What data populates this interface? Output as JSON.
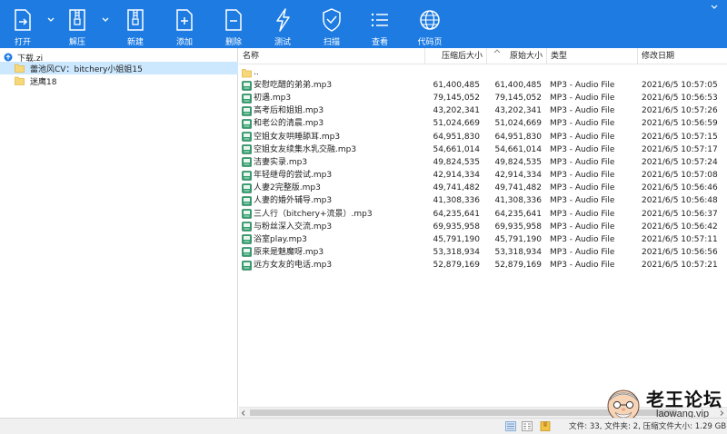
{
  "toolbar": {
    "buttons": [
      {
        "label": "打开",
        "icon": "open-icon"
      },
      {
        "label": "解压",
        "icon": "extract-icon"
      },
      {
        "label": "新建",
        "icon": "new-archive-icon"
      },
      {
        "label": "添加",
        "icon": "add-file-icon"
      },
      {
        "label": "删除",
        "icon": "delete-file-icon"
      },
      {
        "label": "测试",
        "icon": "test-icon"
      },
      {
        "label": "扫描",
        "icon": "scan-shield-icon"
      },
      {
        "label": "查看",
        "icon": "view-list-icon"
      },
      {
        "label": "代码页",
        "icon": "globe-icon"
      }
    ],
    "background": "#1d7be2"
  },
  "tree": {
    "root": "下载.zi",
    "items": [
      {
        "label": "蕾池风CV：bitchery小姐姐15",
        "selected": true
      },
      {
        "label": "迷鹰18",
        "selected": false
      }
    ]
  },
  "columns": {
    "name": "名称",
    "compressed": "压缩后大小",
    "original": "原始大小",
    "type": "类型",
    "modified": "修改日期"
  },
  "parent_row": "..",
  "files": [
    {
      "name": "安慰吃醋的弟弟.mp3",
      "compressed": "61,400,485",
      "original": "61,400,485",
      "type": "MP3 - Audio File",
      "modified": "2021/6/5 10:57:05"
    },
    {
      "name": "初遇.mp3",
      "compressed": "79,145,052",
      "original": "79,145,052",
      "type": "MP3 - Audio File",
      "modified": "2021/6/5 10:56:53"
    },
    {
      "name": "高考后和姐姐.mp3",
      "compressed": "43,202,341",
      "original": "43,202,341",
      "type": "MP3 - Audio File",
      "modified": "2021/6/5 10:57:26"
    },
    {
      "name": "和老公的清晨.mp3",
      "compressed": "51,024,669",
      "original": "51,024,669",
      "type": "MP3 - Audio File",
      "modified": "2021/6/5 10:56:59"
    },
    {
      "name": "空姐女友哄睡舔耳.mp3",
      "compressed": "64,951,830",
      "original": "64,951,830",
      "type": "MP3 - Audio File",
      "modified": "2021/6/5 10:57:15"
    },
    {
      "name": "空姐女友续集水乳交融.mp3",
      "compressed": "54,661,014",
      "original": "54,661,014",
      "type": "MP3 - Audio File",
      "modified": "2021/6/5 10:57:17"
    },
    {
      "name": "洁妻实录.mp3",
      "compressed": "49,824,535",
      "original": "49,824,535",
      "type": "MP3 - Audio File",
      "modified": "2021/6/5 10:57:24"
    },
    {
      "name": "年轻继母的尝试.mp3",
      "compressed": "42,914,334",
      "original": "42,914,334",
      "type": "MP3 - Audio File",
      "modified": "2021/6/5 10:57:08"
    },
    {
      "name": "人妻2完整版.mp3",
      "compressed": "49,741,482",
      "original": "49,741,482",
      "type": "MP3 - Audio File",
      "modified": "2021/6/5 10:56:46"
    },
    {
      "name": "人妻的婚外辅导.mp3",
      "compressed": "41,308,336",
      "original": "41,308,336",
      "type": "MP3 - Audio File",
      "modified": "2021/6/5 10:56:48"
    },
    {
      "name": "三人行（bitchery+流景）.mp3",
      "compressed": "64,235,641",
      "original": "64,235,641",
      "type": "MP3 - Audio File",
      "modified": "2021/6/5 10:56:37"
    },
    {
      "name": "与粉丝深入交流.mp3",
      "compressed": "69,935,958",
      "original": "69,935,958",
      "type": "MP3 - Audio File",
      "modified": "2021/6/5 10:56:42"
    },
    {
      "name": "浴室play.mp3",
      "compressed": "45,791,190",
      "original": "45,791,190",
      "type": "MP3 - Audio File",
      "modified": "2021/6/5 10:57:11"
    },
    {
      "name": "原来是魅魔呀.mp3",
      "compressed": "53,318,934",
      "original": "53,318,934",
      "type": "MP3 - Audio File",
      "modified": "2021/6/5 10:56:56"
    },
    {
      "name": "远方女友的电话.mp3",
      "compressed": "52,879,169",
      "original": "52,879,169",
      "type": "MP3 - Audio File",
      "modified": "2021/6/5 10:57:21"
    }
  ],
  "status": {
    "text": "文件: 33, 文件夹: 2, 压缩文件大小: 1.29 GB"
  },
  "watermark": {
    "title": "老王论坛",
    "url": "laowang.vip"
  }
}
